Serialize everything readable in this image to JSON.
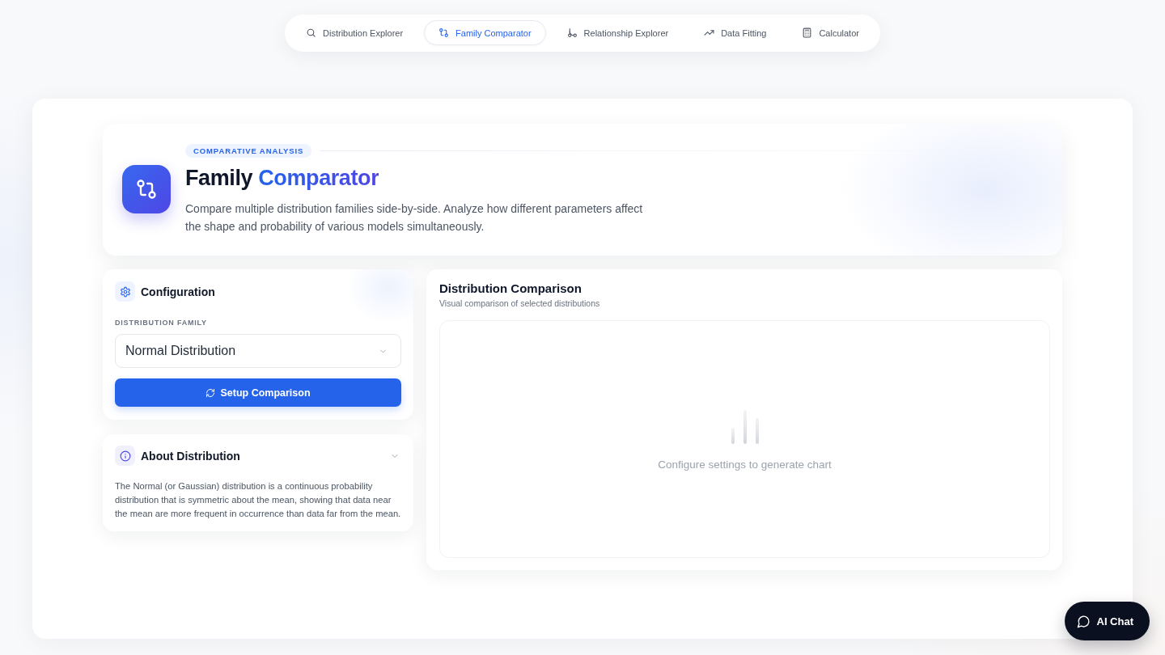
{
  "nav": {
    "tabs": [
      {
        "label": "Distribution Explorer",
        "selected": false
      },
      {
        "label": "Family Comparator",
        "selected": true
      },
      {
        "label": "Relationship Explorer",
        "selected": false
      },
      {
        "label": "Data Fitting",
        "selected": false
      },
      {
        "label": "Calculator",
        "selected": false
      }
    ]
  },
  "header": {
    "tag": "COMPARATIVE ANALYSIS",
    "title": "Family",
    "title_accent": "Comparator",
    "description": "Compare multiple distribution families side-by-side. Analyze how different parameters affect the shape and probability of various models simultaneously."
  },
  "configuration": {
    "title": "Configuration",
    "field_label": "DISTRIBUTION FAMILY",
    "select_value": "Normal Distribution",
    "button": "Setup Comparison"
  },
  "about": {
    "title": "About Distribution",
    "expanded": true,
    "text": "The Normal (or Gaussian) distribution is a continuous probability distribution that is symmetric about the mean, showing that data near the mean are more frequent in occurrence than data far from the mean."
  },
  "chart_panel": {
    "title": "Distribution Comparison",
    "subtitle": "Visual comparison of selected distributions",
    "empty_message": "Configure settings to generate chart"
  },
  "chat_button": {
    "label": "AI Chat"
  }
}
